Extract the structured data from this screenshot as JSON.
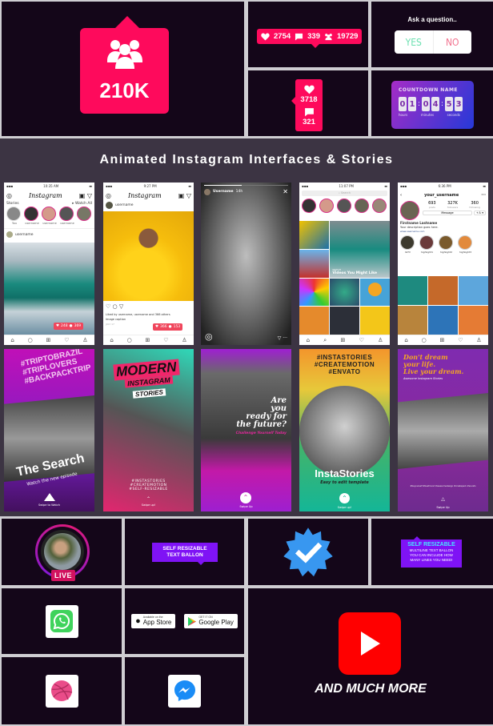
{
  "followers": {
    "icon": "users-icon",
    "count": "210K",
    "color": "#fe0a5c"
  },
  "stat_bar": {
    "likes": "2754",
    "comments": "339",
    "followers": "19729"
  },
  "question": {
    "title": "Ask a question..",
    "yes": "YES",
    "no": "NO"
  },
  "vertical_stat": {
    "likes": "3718",
    "comments": "321"
  },
  "countdown": {
    "name": "COUNTDOWN NAME",
    "digits": [
      "0",
      "1",
      "0",
      "4",
      "5",
      "3"
    ],
    "labels": [
      "hours",
      "minutes",
      "seconds"
    ]
  },
  "banner": {
    "title": "Animated Instagram Interfaces & Stories"
  },
  "phones": {
    "feed": {
      "time": "10:35 AM",
      "logo": "Instagram",
      "stories_label": "Stories",
      "watch_all": "▸ Watch All",
      "story_names": [
        "You",
        "username",
        "username",
        "username"
      ],
      "post_user": "username",
      "likes": "248",
      "comments": "369"
    },
    "post": {
      "time": "9:27 PM",
      "logo": "Instagram",
      "user": "username",
      "liked_by": "Liked by username, username and 366 others",
      "caption": "Image caption",
      "date": "JULY 17",
      "likes": "366",
      "comments": "153"
    },
    "story": {
      "user": "Username",
      "age": "14h"
    },
    "explore": {
      "time": "11:07 PM",
      "search_placeholder": "Search",
      "story_names": [
        "username",
        "username",
        "username",
        "username",
        "username"
      ],
      "watch_label": "WATCH",
      "watch_title": "Videos You Might Like"
    },
    "profile": {
      "time": "6:36 PM",
      "username": "your_username",
      "posts": "693",
      "posts_label": "posts",
      "followers": "327K",
      "followers_label": "followers",
      "following": "360",
      "following_label": "following",
      "message": "Message",
      "name": "Firstname Lastname",
      "description": "Your description goes here.",
      "url": "www.username.com",
      "highlights": [
        "IGTV",
        "highlight1",
        "highlight2",
        "highlight3"
      ]
    }
  },
  "stories": {
    "s1": {
      "hashtags": [
        "#TRIPTOBRAZIL",
        "#TRIPLOVERS",
        "#BACKPACKTRIP"
      ],
      "title": "The Search",
      "subtitle": "Watch the new episode",
      "swipe": "Swipe to Watch"
    },
    "s2": {
      "line1": "MODERN",
      "line2": "INSTAGRAM",
      "line3": "STORIES",
      "hashtags": [
        "#INSTASTORIES",
        "#CREATEMOTION",
        "#SELF-RESIZABLE"
      ],
      "swipe": "Swipe up!"
    },
    "s3": {
      "title": [
        "Are",
        "you",
        "ready for",
        "the future?"
      ],
      "subtitle": "Challenge Yourself Today",
      "swipe": "Swipe Up"
    },
    "s4": {
      "hashtags": [
        "#INSTASTORIES",
        "#CREATEMOTION",
        "#ENVATO"
      ],
      "title": "InstaStories",
      "subtitle": "Easy to edit template",
      "swipe": "Swipe up!"
    },
    "s5": {
      "title": [
        "Don't dream",
        "your life.",
        "Live your dream."
      ],
      "subtitle": "Awesome Instagram Stories",
      "tags": "#beyourself #bestmood #awesomedesign #createpack #envato",
      "swipe": "Swipe Up"
    }
  },
  "live": {
    "label": "LIVE"
  },
  "balloon1": {
    "lines": [
      "SELF RESIZABLE",
      "TEXT BALLON"
    ]
  },
  "verified": {
    "icon": "verified-badge-icon",
    "color": "#3897f0"
  },
  "balloon2": {
    "title": "SELF RESIZABLE",
    "lines": [
      "MULTILINE TEXT BALLON",
      "YOU CAN INCLUDE HOW",
      "MANY LINES YOU NEED!"
    ]
  },
  "apps": {
    "whatsapp": "whatsapp-icon",
    "app_store_small": "Available on the",
    "app_store_large": "App Store",
    "google_small": "GET IT ON",
    "google_large": "Google Play",
    "dribbble": "dribbble-icon",
    "messenger": "messenger-icon"
  },
  "youtube": {
    "icon": "youtube-play-icon",
    "caption": "AND MUCH MORE",
    "color": "#ff0000"
  }
}
